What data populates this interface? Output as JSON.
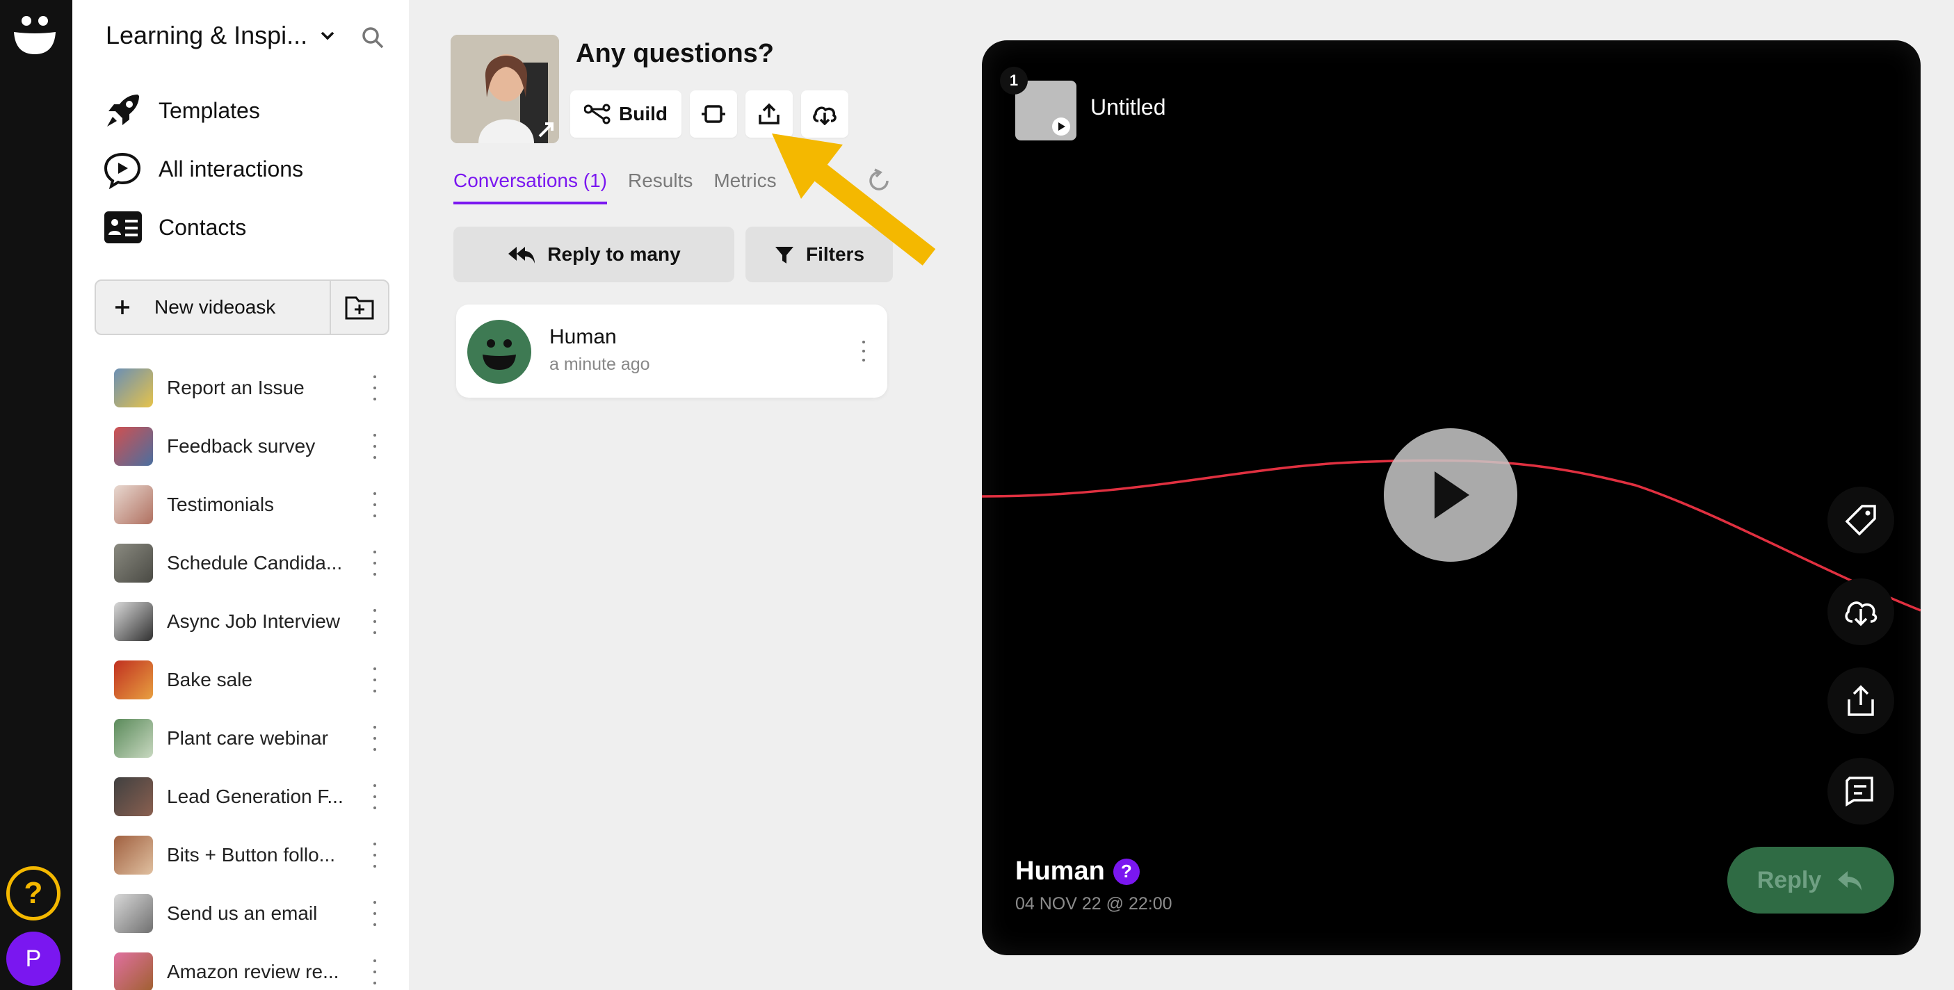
{
  "workspace": {
    "title": "Learning & Inspi..."
  },
  "nav": [
    {
      "label": "Templates",
      "icon": "rocket-icon"
    },
    {
      "label": "All interactions",
      "icon": "interactions-icon"
    },
    {
      "label": "Contacts",
      "icon": "contacts-icon"
    }
  ],
  "new_videoask": {
    "label": "New videoask"
  },
  "videoasks": [
    {
      "label": "Report an Issue"
    },
    {
      "label": "Feedback survey"
    },
    {
      "label": "Testimonials"
    },
    {
      "label": "Schedule Candida..."
    },
    {
      "label": "Async Job Interview"
    },
    {
      "label": "Bake sale"
    },
    {
      "label": "Plant care webinar"
    },
    {
      "label": "Lead Generation F..."
    },
    {
      "label": "Bits + Button follo..."
    },
    {
      "label": "Send us an email"
    },
    {
      "label": "Amazon review re..."
    }
  ],
  "rail": {
    "help": "?",
    "user_initial": "P"
  },
  "header": {
    "title": "Any questions?",
    "build_label": "Build"
  },
  "tabs": [
    {
      "label": "Conversations (1)",
      "active": true
    },
    {
      "label": "Results",
      "active": false
    },
    {
      "label": "Metrics",
      "active": false
    }
  ],
  "actions": {
    "reply_many": "Reply to many",
    "filters": "Filters"
  },
  "conversation": {
    "name": "Human",
    "time": "a minute ago"
  },
  "player": {
    "step_number": "1",
    "step_title": "Untitled",
    "respondent": "Human",
    "respondent_badge": "?",
    "date": "04 NOV 22 @ 22:00",
    "reply_label": "Reply"
  },
  "colors": {
    "accent": "#7a17f0",
    "annotation": "#f4b800",
    "reply": "#2f6b44",
    "wave": "#e03040"
  }
}
